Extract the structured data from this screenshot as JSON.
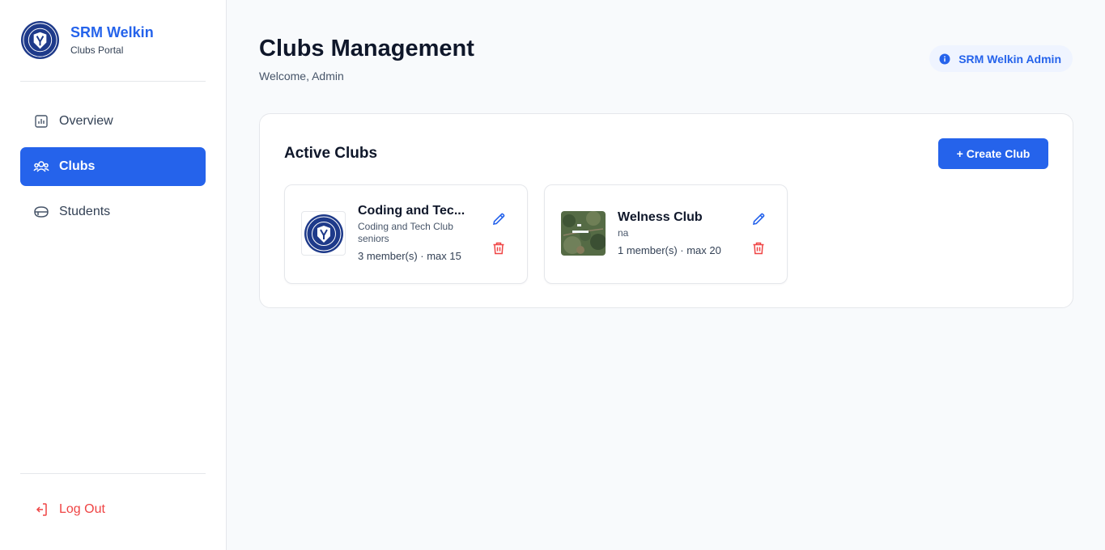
{
  "brand": {
    "name": "SRM Welkin",
    "subtitle": "Clubs Portal"
  },
  "sidebar": {
    "items": [
      {
        "label": "Overview",
        "icon": "bar-chart-icon",
        "active": false
      },
      {
        "label": "Clubs",
        "icon": "users-icon",
        "active": true
      },
      {
        "label": "Students",
        "icon": "graduation-cap-icon",
        "active": false
      }
    ],
    "logout_label": "Log Out"
  },
  "header": {
    "title": "Clubs Management",
    "welcome": "Welcome, Admin",
    "badge": "SRM Welkin Admin"
  },
  "panel": {
    "title": "Active Clubs",
    "create_label": "+ Create Club"
  },
  "clubs": [
    {
      "name": "Coding and Tec...",
      "description": "Coding and Tech Club seniors",
      "meta": "3 member(s) · max 15",
      "thumbnail": "school-crest"
    },
    {
      "name": "Welness Club",
      "description": "na",
      "meta": "1 member(s) · max 20",
      "thumbnail": "aerial-photo"
    }
  ],
  "colors": {
    "accent": "#2563eb",
    "danger": "#ef4444",
    "background": "#f8fafc"
  }
}
